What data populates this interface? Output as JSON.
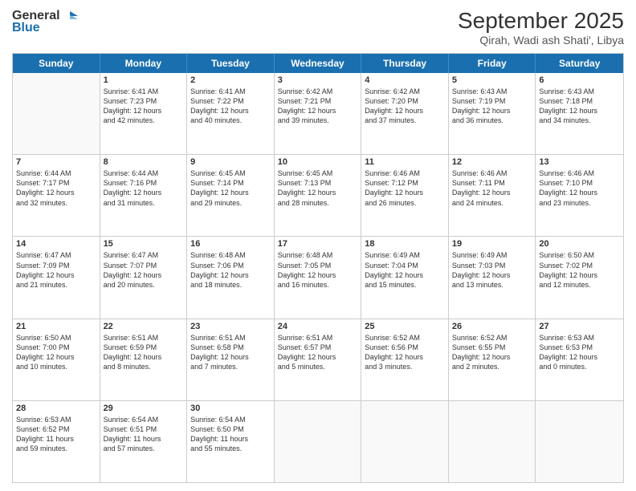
{
  "header": {
    "logo_line1": "General",
    "logo_line2": "Blue",
    "title": "September 2025",
    "subtitle": "Qirah, Wadi ash Shati', Libya"
  },
  "days": [
    "Sunday",
    "Monday",
    "Tuesday",
    "Wednesday",
    "Thursday",
    "Friday",
    "Saturday"
  ],
  "weeks": [
    [
      {
        "day": "",
        "content": ""
      },
      {
        "day": "1",
        "content": "Sunrise: 6:41 AM\nSunset: 7:23 PM\nDaylight: 12 hours\nand 42 minutes."
      },
      {
        "day": "2",
        "content": "Sunrise: 6:41 AM\nSunset: 7:22 PM\nDaylight: 12 hours\nand 40 minutes."
      },
      {
        "day": "3",
        "content": "Sunrise: 6:42 AM\nSunset: 7:21 PM\nDaylight: 12 hours\nand 39 minutes."
      },
      {
        "day": "4",
        "content": "Sunrise: 6:42 AM\nSunset: 7:20 PM\nDaylight: 12 hours\nand 37 minutes."
      },
      {
        "day": "5",
        "content": "Sunrise: 6:43 AM\nSunset: 7:19 PM\nDaylight: 12 hours\nand 36 minutes."
      },
      {
        "day": "6",
        "content": "Sunrise: 6:43 AM\nSunset: 7:18 PM\nDaylight: 12 hours\nand 34 minutes."
      }
    ],
    [
      {
        "day": "7",
        "content": "Sunrise: 6:44 AM\nSunset: 7:17 PM\nDaylight: 12 hours\nand 32 minutes."
      },
      {
        "day": "8",
        "content": "Sunrise: 6:44 AM\nSunset: 7:16 PM\nDaylight: 12 hours\nand 31 minutes."
      },
      {
        "day": "9",
        "content": "Sunrise: 6:45 AM\nSunset: 7:14 PM\nDaylight: 12 hours\nand 29 minutes."
      },
      {
        "day": "10",
        "content": "Sunrise: 6:45 AM\nSunset: 7:13 PM\nDaylight: 12 hours\nand 28 minutes."
      },
      {
        "day": "11",
        "content": "Sunrise: 6:46 AM\nSunset: 7:12 PM\nDaylight: 12 hours\nand 26 minutes."
      },
      {
        "day": "12",
        "content": "Sunrise: 6:46 AM\nSunset: 7:11 PM\nDaylight: 12 hours\nand 24 minutes."
      },
      {
        "day": "13",
        "content": "Sunrise: 6:46 AM\nSunset: 7:10 PM\nDaylight: 12 hours\nand 23 minutes."
      }
    ],
    [
      {
        "day": "14",
        "content": "Sunrise: 6:47 AM\nSunset: 7:09 PM\nDaylight: 12 hours\nand 21 minutes."
      },
      {
        "day": "15",
        "content": "Sunrise: 6:47 AM\nSunset: 7:07 PM\nDaylight: 12 hours\nand 20 minutes."
      },
      {
        "day": "16",
        "content": "Sunrise: 6:48 AM\nSunset: 7:06 PM\nDaylight: 12 hours\nand 18 minutes."
      },
      {
        "day": "17",
        "content": "Sunrise: 6:48 AM\nSunset: 7:05 PM\nDaylight: 12 hours\nand 16 minutes."
      },
      {
        "day": "18",
        "content": "Sunrise: 6:49 AM\nSunset: 7:04 PM\nDaylight: 12 hours\nand 15 minutes."
      },
      {
        "day": "19",
        "content": "Sunrise: 6:49 AM\nSunset: 7:03 PM\nDaylight: 12 hours\nand 13 minutes."
      },
      {
        "day": "20",
        "content": "Sunrise: 6:50 AM\nSunset: 7:02 PM\nDaylight: 12 hours\nand 12 minutes."
      }
    ],
    [
      {
        "day": "21",
        "content": "Sunrise: 6:50 AM\nSunset: 7:00 PM\nDaylight: 12 hours\nand 10 minutes."
      },
      {
        "day": "22",
        "content": "Sunrise: 6:51 AM\nSunset: 6:59 PM\nDaylight: 12 hours\nand 8 minutes."
      },
      {
        "day": "23",
        "content": "Sunrise: 6:51 AM\nSunset: 6:58 PM\nDaylight: 12 hours\nand 7 minutes."
      },
      {
        "day": "24",
        "content": "Sunrise: 6:51 AM\nSunset: 6:57 PM\nDaylight: 12 hours\nand 5 minutes."
      },
      {
        "day": "25",
        "content": "Sunrise: 6:52 AM\nSunset: 6:56 PM\nDaylight: 12 hours\nand 3 minutes."
      },
      {
        "day": "26",
        "content": "Sunrise: 6:52 AM\nSunset: 6:55 PM\nDaylight: 12 hours\nand 2 minutes."
      },
      {
        "day": "27",
        "content": "Sunrise: 6:53 AM\nSunset: 6:53 PM\nDaylight: 12 hours\nand 0 minutes."
      }
    ],
    [
      {
        "day": "28",
        "content": "Sunrise: 6:53 AM\nSunset: 6:52 PM\nDaylight: 11 hours\nand 59 minutes."
      },
      {
        "day": "29",
        "content": "Sunrise: 6:54 AM\nSunset: 6:51 PM\nDaylight: 11 hours\nand 57 minutes."
      },
      {
        "day": "30",
        "content": "Sunrise: 6:54 AM\nSunset: 6:50 PM\nDaylight: 11 hours\nand 55 minutes."
      },
      {
        "day": "",
        "content": ""
      },
      {
        "day": "",
        "content": ""
      },
      {
        "day": "",
        "content": ""
      },
      {
        "day": "",
        "content": ""
      }
    ]
  ]
}
